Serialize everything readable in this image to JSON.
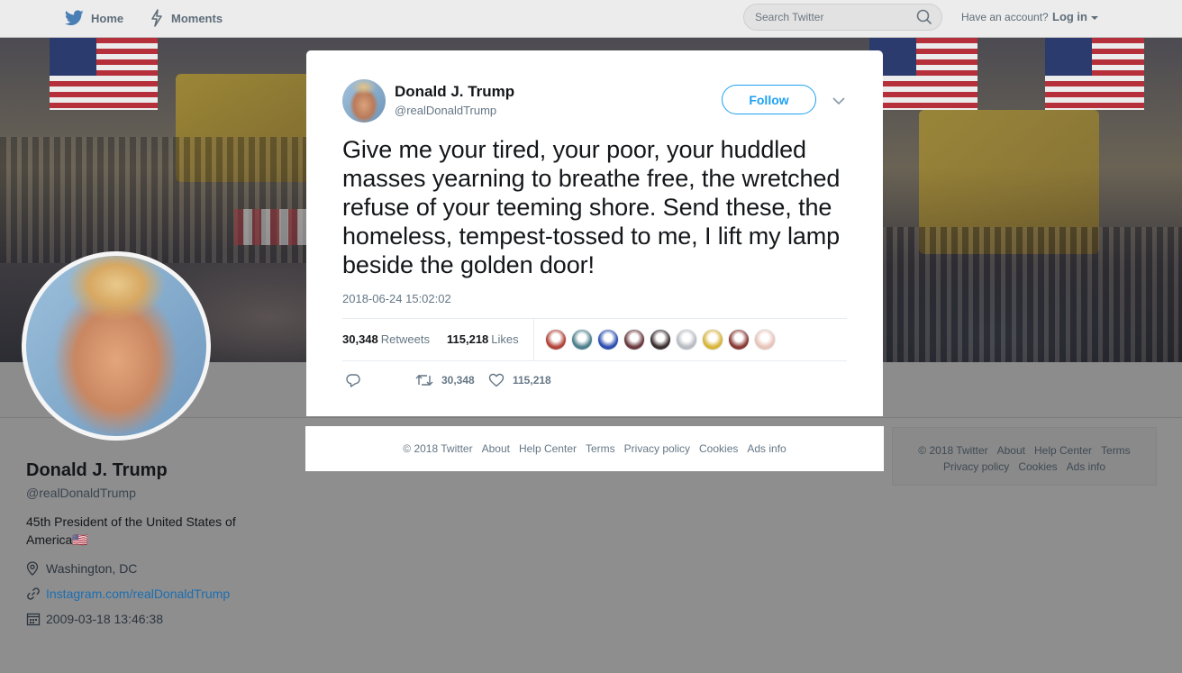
{
  "nav": {
    "home_label": "Home",
    "moments_label": "Moments",
    "search_placeholder": "Search Twitter",
    "have_account": "Have an account?",
    "login_label": "Log in"
  },
  "profile": {
    "name": "Donald J. Trump",
    "handle": "@realDonaldTrump",
    "bio": "45th President of the United States of America🇺🇸",
    "location": "Washington, DC",
    "url": "Instagram.com/realDonaldTrump",
    "joined": "2009-03-18 13:46:38"
  },
  "tweet": {
    "name": "Donald J. Trump",
    "handle": "@realDonaldTrump",
    "follow_label": "Follow",
    "text": "Give me your tired, your poor, your huddled masses yearning to breathe free, the wretched refuse of your teeming shore. Send these, the homeless, tempest-tossed to me, I lift my lamp beside the golden door!",
    "timestamp": "2018-06-24 15:02:02",
    "retweets_count": "30,348",
    "retweets_label": "Retweets",
    "likes_count": "115,218",
    "likes_label": "Likes",
    "action_retweets": "30,348",
    "action_likes": "115,218",
    "liker_colors": [
      "#b3443a",
      "#4d7f8c",
      "#2f4fb0",
      "#6b3a3e",
      "#3b3030",
      "#b8bcc2",
      "#d8b43a",
      "#8a3b34",
      "#e8c4b8"
    ]
  },
  "modal_footer": [
    "© 2018 Twitter",
    "About",
    "Help Center",
    "Terms",
    "Privacy policy",
    "Cookies",
    "Ads info"
  ],
  "side_footer": {
    "line1": [
      "© 2018 Twitter",
      "About",
      "Help Center",
      "Terms"
    ],
    "line2": [
      "Privacy policy",
      "Cookies",
      "Ads info"
    ]
  },
  "colors": {
    "accent": "#1da1f2",
    "link": "#1b6fb3",
    "overlay": "#8e8e8e"
  }
}
